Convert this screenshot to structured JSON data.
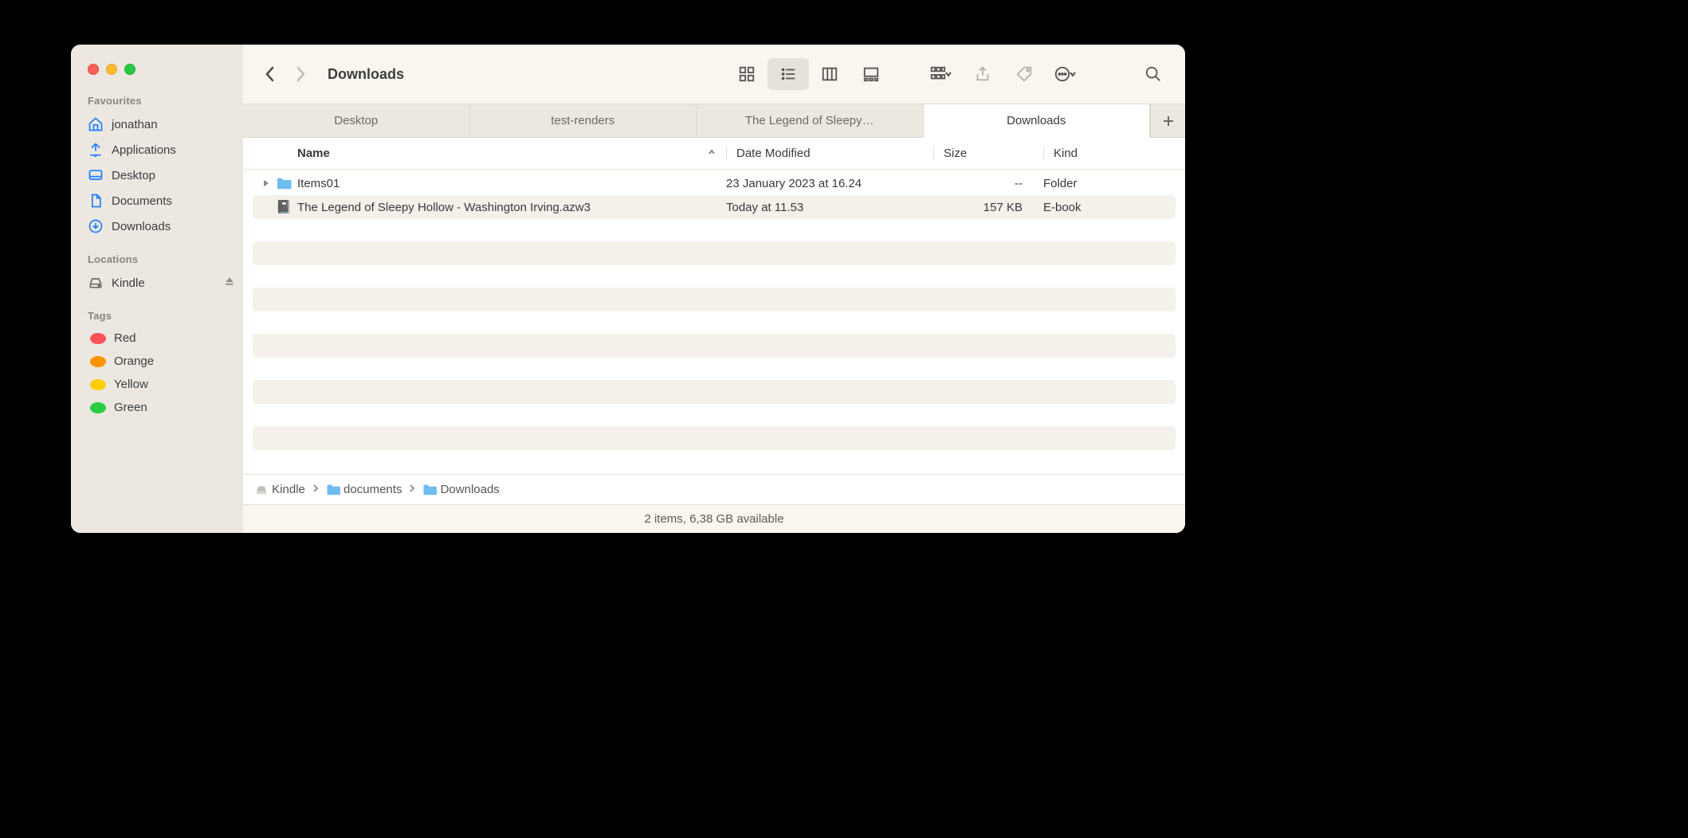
{
  "window_title": "Downloads",
  "sidebar": {
    "favourites_header": "Favourites",
    "favourites": [
      {
        "icon": "home",
        "label": "jonathan"
      },
      {
        "icon": "apps",
        "label": "Applications"
      },
      {
        "icon": "desktop",
        "label": "Desktop"
      },
      {
        "icon": "doc",
        "label": "Documents"
      },
      {
        "icon": "download",
        "label": "Downloads"
      }
    ],
    "locations_header": "Locations",
    "locations": [
      {
        "icon": "drive",
        "label": "Kindle",
        "ejectable": true
      }
    ],
    "tags_header": "Tags",
    "tags": [
      {
        "color": "#ff5257",
        "label": "Red"
      },
      {
        "color": "#ff9500",
        "label": "Orange"
      },
      {
        "color": "#ffcc02",
        "label": "Yellow"
      },
      {
        "color": "#28cd41",
        "label": "Green"
      }
    ]
  },
  "toolbar": {
    "view_modes": [
      "icons",
      "list",
      "columns",
      "gallery"
    ],
    "active_view": "list"
  },
  "tabs": [
    {
      "label": "Desktop",
      "active": false
    },
    {
      "label": "test-renders",
      "active": false
    },
    {
      "label": "The Legend of Sleepy…",
      "active": false
    },
    {
      "label": "Downloads",
      "active": true
    }
  ],
  "columns": {
    "name": "Name",
    "date": "Date Modified",
    "size": "Size",
    "kind": "Kind",
    "sort_asc_on": "name"
  },
  "rows": [
    {
      "icon": "folder",
      "expandable": true,
      "name": "Items01",
      "date": "23 January 2023 at 16.24",
      "size": "--",
      "kind": "Folder"
    },
    {
      "icon": "book",
      "expandable": false,
      "name": "The Legend of Sleepy Hollow - Washington Irving.azw3",
      "date": "Today at 11.53",
      "size": "157 KB",
      "kind": "E-book"
    }
  ],
  "pathbar": [
    {
      "icon": "drive",
      "label": "Kindle"
    },
    {
      "icon": "folder",
      "label": "documents"
    },
    {
      "icon": "folder",
      "label": "Downloads"
    }
  ],
  "status": "2 items, 6,38 GB available"
}
